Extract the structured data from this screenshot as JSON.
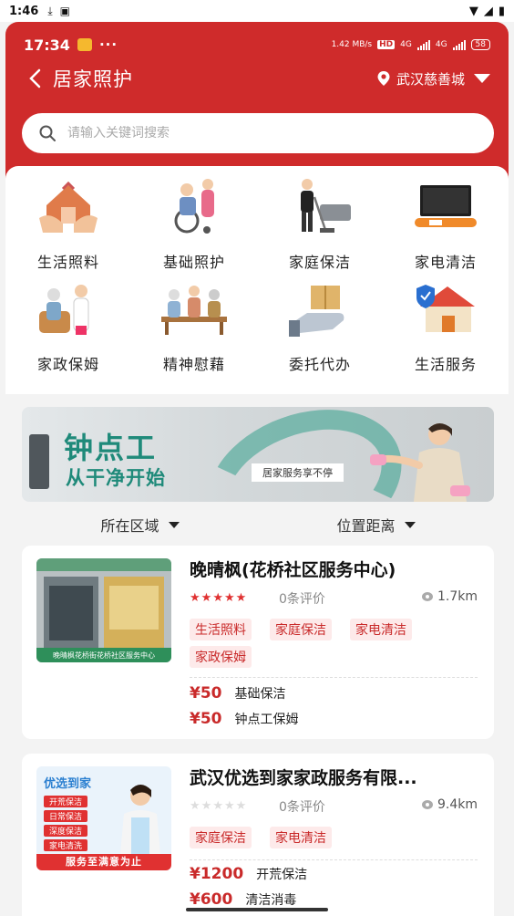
{
  "system_status": {
    "time": "1:46"
  },
  "inner_status": {
    "time": "17:34",
    "dots": "···",
    "speed": "1.42 MB/s",
    "hd": "HD",
    "net1": "4G",
    "net2": "4G",
    "battery": "58"
  },
  "nav": {
    "title": "居家照护",
    "location": "武汉慈善城"
  },
  "search": {
    "placeholder": "请输入关键词搜索"
  },
  "categories": [
    {
      "label": "生活照料",
      "icon": "house-hands-icon"
    },
    {
      "label": "基础照护",
      "icon": "wheelchair-care-icon"
    },
    {
      "label": "家庭保洁",
      "icon": "cleaning-icon"
    },
    {
      "label": "家电清洁",
      "icon": "tv-icon"
    },
    {
      "label": "家政保姆",
      "icon": "nanny-icon"
    },
    {
      "label": "精神慰藉",
      "icon": "companions-icon"
    },
    {
      "label": "委托代办",
      "icon": "delivery-hand-icon"
    },
    {
      "label": "生活服务",
      "icon": "home-shield-icon"
    }
  ],
  "banner": {
    "title": "钟点工",
    "subtitle": "从干净开始",
    "slogan": "居家服务享不停"
  },
  "filters": {
    "area": "所在区域",
    "distance": "位置距离"
  },
  "providers": [
    {
      "name": "晚晴枫(花桥社区服务中心)",
      "rating": 5,
      "reviews": "0条评价",
      "distance": "1.7km",
      "thumb_caption": "晚晴枫花桥街花桥社区服务中心",
      "tags": [
        "生活照料",
        "家庭保洁",
        "家电清洁",
        "家政保姆"
      ],
      "services": [
        {
          "price": "¥50",
          "name": "基础保洁"
        },
        {
          "price": "¥50",
          "name": "钟点工保姆"
        }
      ]
    },
    {
      "name": "武汉优选到家家政服务有限...",
      "rating": 0,
      "reviews": "0条评价",
      "distance": "9.4km",
      "thumb_title": "优选到家",
      "thumb_items": [
        "开荒保洁",
        "日常保洁",
        "深度保洁",
        "家电清洗"
      ],
      "thumb_footer": "服务至满意为止",
      "tags": [
        "家庭保洁",
        "家电清洁"
      ],
      "services": [
        {
          "price": "¥1200",
          "name": "开荒保洁"
        },
        {
          "price": "¥600",
          "name": "清洁消毒"
        }
      ]
    }
  ],
  "colors": {
    "brand_red": "#cf2b2b",
    "tag_bg": "#fdeaea",
    "star": "#e03131",
    "teal": "#1f8a7a"
  }
}
